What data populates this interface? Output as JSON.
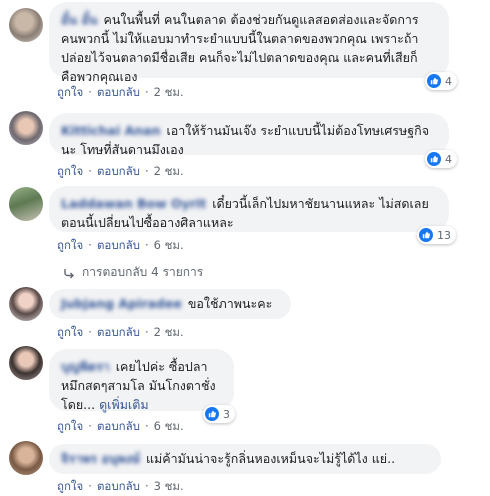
{
  "comments": [
    {
      "name": "อั๋น อั๋น",
      "text": "คนในพื้นที่ คนในตลาด ต้องช่วยกันดูแลสอดส่องและจัดการคนพวกนี้ ไม่ให้แอบมาทำระยำแบบนี้ในตลาดของพวกคุณ เพราะถ้าปล่อยไว้จนตลาดมีชื่อเสีย คนก็จะไม่ไปตลาดของคุณ และคนที่เสียก็คือพวกคุณเอง",
      "reactions": "4",
      "like": "ถูกใจ",
      "reply": "ตอบกลับ",
      "time": "2 ชม."
    },
    {
      "name": "Kittichai Anan",
      "text": "เอาให้ร้านมันเจ๊ง ระยำแบบนี้ไม่ต้องโทษเศรษฐกิจนะ โทษที่สันดานมึงเอง",
      "reactions": "4",
      "like": "ถูกใจ",
      "reply": "ตอบกลับ",
      "time": "2 ชม."
    },
    {
      "name": "Laddawan Bow Oyrit",
      "text": "เดี๋ยวนี้เล็กไปมหาชัยนานแหละ ไม่สดเลย ตอนนี้เปลี่ยนไปซื้ออางศิลาแหละ",
      "reactions": "13",
      "like": "ถูกใจ",
      "reply": "ตอบกลับ",
      "time": "6 ชม."
    },
    {
      "name": "Jubjang Apiradee",
      "text": "ขอใช้ภาพนะคะ",
      "like": "ถูกใจ",
      "reply": "ตอบกลับ",
      "time": "2 ชม."
    },
    {
      "name": "บุญพิตรา",
      "text": "เคยไปค่ะ ซื้อปลาหมึกสดๆสามโล มันโกงตาชั่งโดย...",
      "see_more": "ดูเพิ่มเติม",
      "reactions": "3",
      "like": "ถูกใจ",
      "reply": "ตอบกลับ",
      "time": "6 ชม."
    },
    {
      "name": "จิราพร อนุพงษ์",
      "text": "แม่ค้ามันน่าจะรู้กลิ่นหองเหม็นจะไม่รู้ได้ไง แย่..",
      "like": "ถูกใจ",
      "reply": "ตอบกลับ",
      "time": "3 ชม."
    }
  ],
  "replies_link": "การตอบกลับ 4 รายการ",
  "colors": {
    "bubble": "#f2f3f5",
    "link": "#385898",
    "like": "#1877f2",
    "meta": "#606770"
  }
}
